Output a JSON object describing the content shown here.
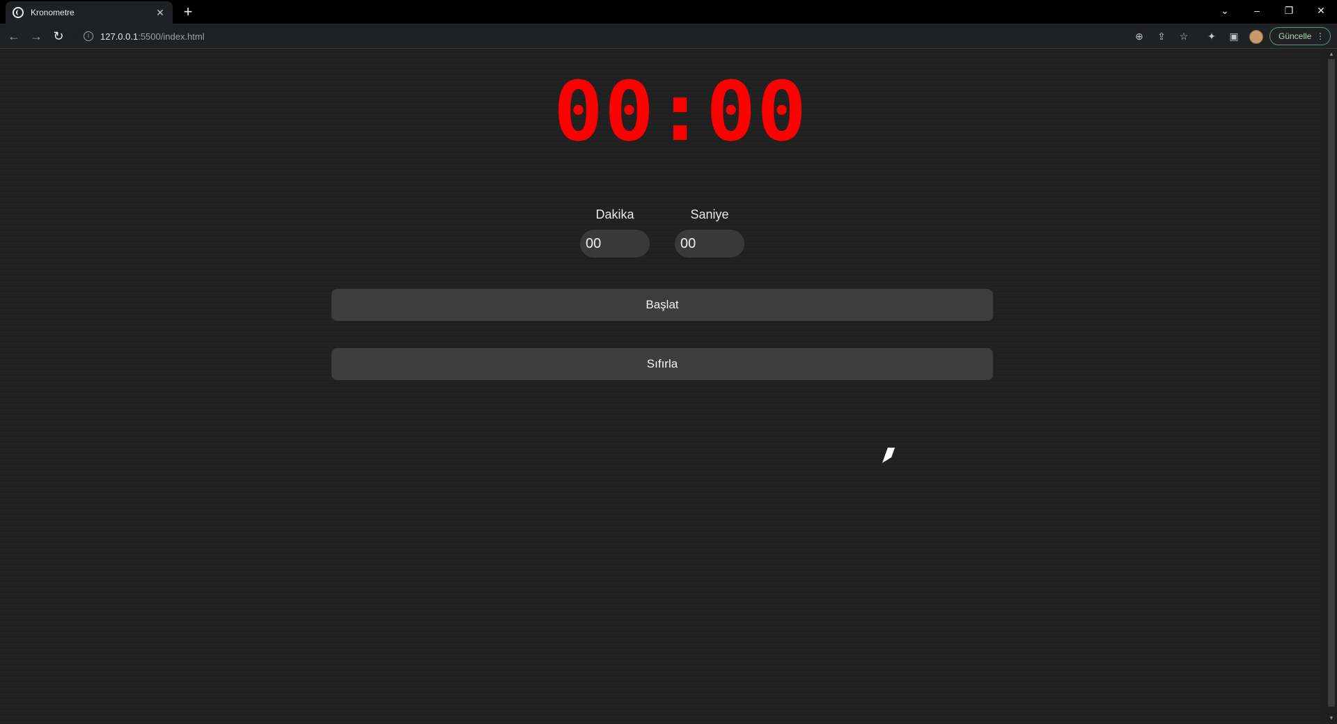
{
  "browser": {
    "tab_title": "Kronometre",
    "url_host": "127.0.0.1",
    "url_path": ":5500/index.html",
    "update_label": "Güncelle"
  },
  "stopwatch": {
    "display": "00:00",
    "minute_label": "Dakika",
    "second_label": "Saniye",
    "minute_value": "00",
    "second_value": "00",
    "start_label": "Başlat",
    "reset_label": "Sıfırla"
  },
  "colors": {
    "display": "#ff0000",
    "background": "#202020",
    "button": "#3d3d3d"
  }
}
